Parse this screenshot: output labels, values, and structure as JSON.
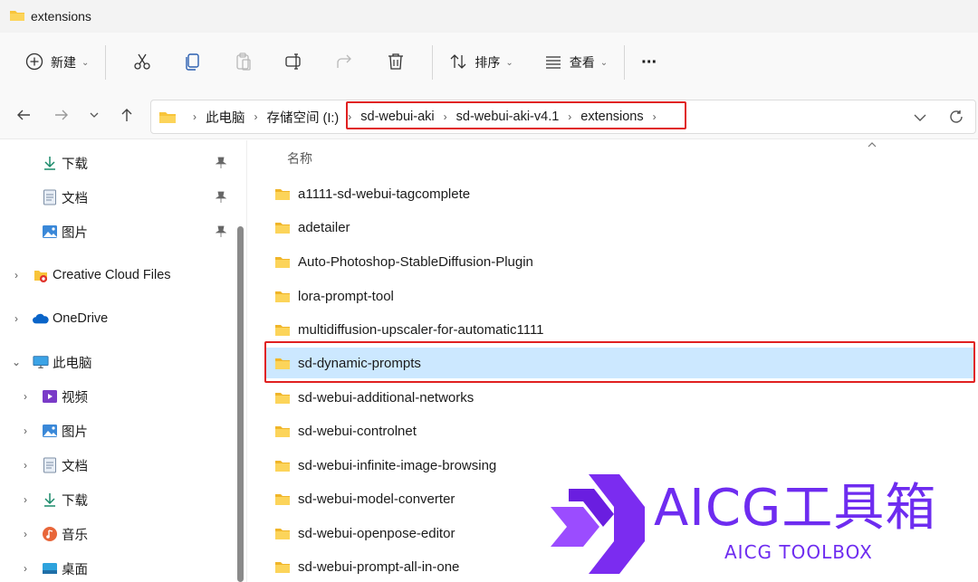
{
  "window": {
    "title": "extensions"
  },
  "toolbar": {
    "new_label": "新建",
    "sort_label": "排序",
    "view_label": "查看",
    "more_label": "···"
  },
  "address": {
    "crumbs": [
      "此电脑",
      "存储空间 (I:)",
      "sd-webui-aki",
      "sd-webui-aki-v4.1",
      "extensions"
    ]
  },
  "sidebar": {
    "quick": [
      {
        "label": "下载",
        "icon": "download-icon"
      },
      {
        "label": "文档",
        "icon": "document-icon"
      },
      {
        "label": "图片",
        "icon": "pictures-icon"
      }
    ],
    "roots": [
      {
        "label": "Creative Cloud Files",
        "icon": "creative-cloud-icon"
      },
      {
        "label": "OneDrive",
        "icon": "onedrive-icon"
      },
      {
        "label": "此电脑",
        "icon": "this-pc-icon"
      }
    ],
    "pc_children": [
      {
        "label": "视频",
        "icon": "videos-icon"
      },
      {
        "label": "图片",
        "icon": "pictures-icon"
      },
      {
        "label": "文档",
        "icon": "document-icon"
      },
      {
        "label": "下载",
        "icon": "download-icon"
      },
      {
        "label": "音乐",
        "icon": "music-icon"
      },
      {
        "label": "桌面",
        "icon": "desktop-icon"
      }
    ]
  },
  "content": {
    "column_name": "名称",
    "files": [
      "a1111-sd-webui-tagcomplete",
      "adetailer",
      "Auto-Photoshop-StableDiffusion-Plugin",
      "lora-prompt-tool",
      "multidiffusion-upscaler-for-automatic1111",
      "sd-dynamic-prompts",
      "sd-webui-additional-networks",
      "sd-webui-controlnet",
      "sd-webui-infinite-image-browsing",
      "sd-webui-model-converter",
      "sd-webui-openpose-editor",
      "sd-webui-prompt-all-in-one"
    ],
    "selected_index": 5
  },
  "watermark": {
    "title": "AICG工具箱",
    "subtitle": "AICG TOOLBOX"
  },
  "colors": {
    "selection": "#cce8ff",
    "highlight_border": "#e02020",
    "watermark": "#6e2cf0",
    "folder": "#f8c43a"
  }
}
